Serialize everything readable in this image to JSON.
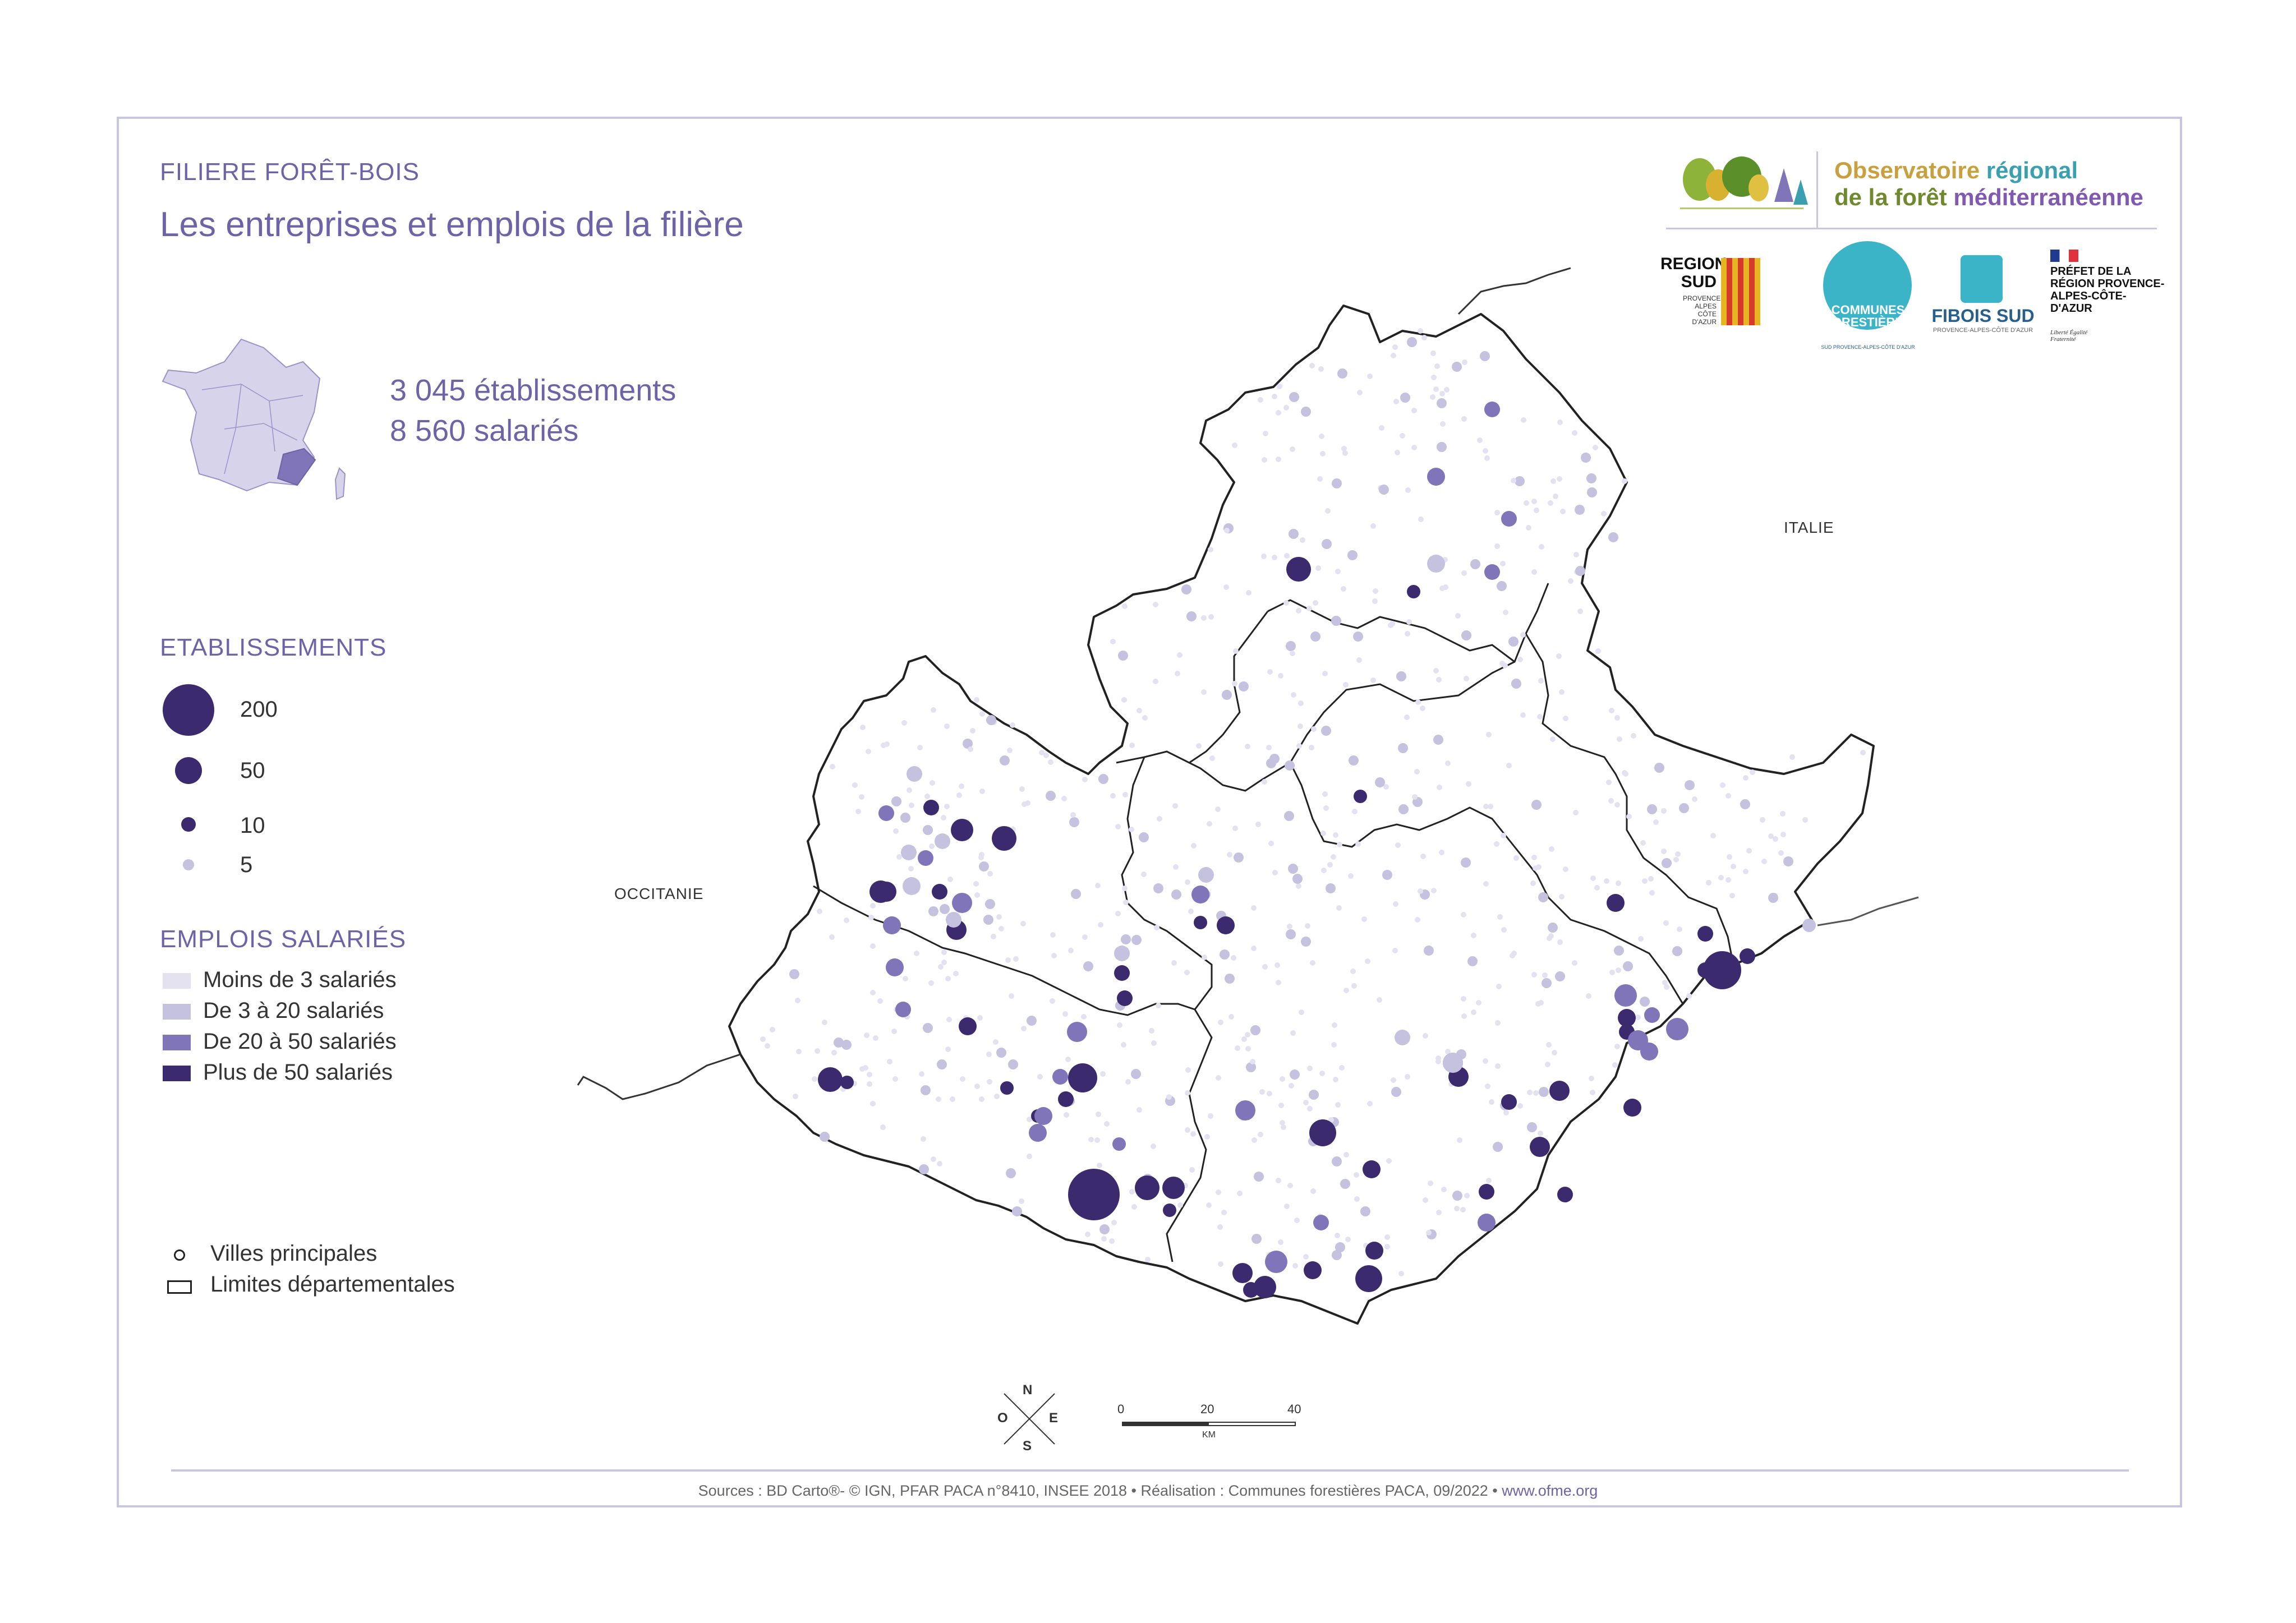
{
  "header": {
    "kicker": "FILIERE FORÊT-BOIS",
    "title": "Les entreprises et emplois de la filière"
  },
  "stats": {
    "establishments": "3 045 établissements",
    "employees": "8 560 salariés"
  },
  "legend_establishments": {
    "title": "ETABLISSEMENTS",
    "items": [
      {
        "label": "200",
        "size": 200
      },
      {
        "label": "50",
        "size": 50
      },
      {
        "label": "10",
        "size": 10
      },
      {
        "label": "5",
        "size": 5
      }
    ]
  },
  "legend_employment": {
    "title": "EMPLOIS SALARIÉS",
    "items": [
      {
        "label": "Moins de 3 salariés",
        "color": "#e4e2f0"
      },
      {
        "label": "De 3 à 20 salariés",
        "color": "#c5c2e0"
      },
      {
        "label": "De 20 à 50 salariés",
        "color": "#7f75b8"
      },
      {
        "label": "Plus de 50 salariés",
        "color": "#3b2a6e"
      }
    ]
  },
  "legend_map": {
    "cities": "Villes principales",
    "departments": "Limites départementales"
  },
  "map_labels": {
    "italy": "ITALIE",
    "occitanie": "OCCITANIE"
  },
  "compass": {
    "n": "N",
    "s": "S",
    "e": "E",
    "o": "O"
  },
  "scale": {
    "ticks": [
      "0",
      "20",
      "40"
    ],
    "unit": "KM"
  },
  "logos": {
    "observatoire_line1_a": "Observatoire ",
    "observatoire_line1_b": "régional",
    "observatoire_line2_a": "de la forêt ",
    "observatoire_line2_b": "méditerranéenne",
    "region_sud": "REGION SUD",
    "region_sub": "PROVENCE ALPES CÔTE D'AZUR",
    "communes": "COMMUNES FORESTIÈRES",
    "communes_sub": "SUD PROVENCE-ALPES-CÔTE D'AZUR",
    "fibois": "FIBOIS SUD",
    "fibois_sub": "PROVENCE-ALPES-CÔTE D'AZUR",
    "prefet": "PRÉFET DE LA RÉGION PROVENCE-ALPES-CÔTE-D'AZUR",
    "prefet_motto": "Liberté Égalité Fraternité"
  },
  "sources": {
    "text": "Sources : BD Carto®- © IGN, PFAR PACA n°8410, INSEE 2018 • Réalisation : Communes forestières PACA, 09/2022 • ",
    "link": "www.ofme.org"
  }
}
